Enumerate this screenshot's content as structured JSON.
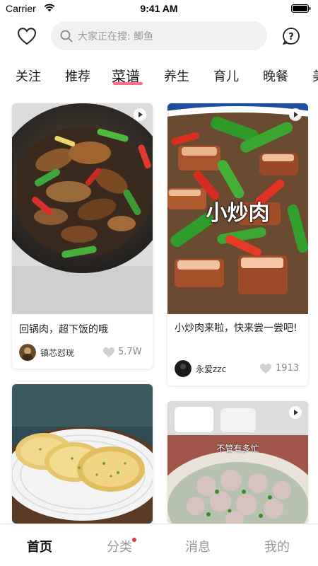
{
  "status_bar": {
    "carrier": "Carrier",
    "time": "9:41 AM"
  },
  "header": {
    "search_placeholder": "大家正在搜: 鲫鱼"
  },
  "tabs": [
    {
      "label": "关注"
    },
    {
      "label": "推荐"
    },
    {
      "label": "菜谱",
      "active": true
    },
    {
      "label": "养生"
    },
    {
      "label": "育儿"
    },
    {
      "label": "晚餐"
    },
    {
      "label": "美"
    }
  ],
  "cards": [
    {
      "title": "回锅肉，超下饭的哦",
      "author": "镇芯怼珖",
      "likes": "5.7W",
      "has_video": true
    },
    {
      "title": "小炒肉来啦，快来尝一尝吧!",
      "overlay_text": "小炒肉",
      "author": "永爱zzc",
      "likes": "1913",
      "has_video": true
    },
    {
      "title": "",
      "has_video": false
    },
    {
      "title": "",
      "overlay_text": "不管有多忙",
      "has_video": true
    }
  ],
  "bottom_nav": [
    {
      "label": "首页",
      "active": true
    },
    {
      "label": "分类",
      "badge_dot": true
    },
    {
      "label": "消息"
    },
    {
      "label": "我的"
    }
  ],
  "colors": {
    "tab_underline": "#ff6f8d",
    "badge_dot": "#e53935"
  },
  "icons": [
    "wifi-icon",
    "battery-icon",
    "heart-icon",
    "search-icon",
    "help-icon",
    "video-play-icon",
    "like-heart-icon"
  ]
}
